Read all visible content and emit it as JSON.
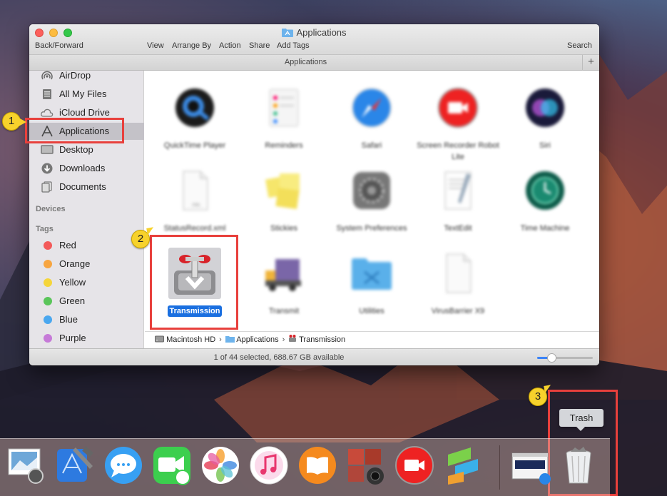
{
  "window": {
    "title": "Applications",
    "toolbar": {
      "back_forward": "Back/Forward",
      "view": "View",
      "arrange_by": "Arrange By",
      "action": "Action",
      "share": "Share",
      "add_tags": "Add Tags",
      "search": "Search"
    },
    "path_tab": "Applications",
    "plus": "+"
  },
  "sidebar": {
    "items": [
      {
        "label": "AirDrop",
        "icon": "airdrop-icon"
      },
      {
        "label": "All My Files",
        "icon": "all-files-icon"
      },
      {
        "label": "iCloud Drive",
        "icon": "cloud-icon"
      },
      {
        "label": "Applications",
        "icon": "applications-icon",
        "selected": true
      },
      {
        "label": "Desktop",
        "icon": "desktop-icon"
      },
      {
        "label": "Downloads",
        "icon": "downloads-icon"
      },
      {
        "label": "Documents",
        "icon": "documents-icon"
      }
    ],
    "devices_header": "Devices",
    "tags_header": "Tags",
    "tags": [
      {
        "label": "Red",
        "color": "#f35a5a"
      },
      {
        "label": "Orange",
        "color": "#f7a540"
      },
      {
        "label": "Yellow",
        "color": "#f5d53a"
      },
      {
        "label": "Green",
        "color": "#5ac55a"
      },
      {
        "label": "Blue",
        "color": "#4aa7ef"
      },
      {
        "label": "Purple",
        "color": "#c67ad8"
      }
    ]
  },
  "apps": [
    {
      "label": "QuickTime Player",
      "icon": "quicktime-icon"
    },
    {
      "label": "Reminders",
      "icon": "reminders-icon"
    },
    {
      "label": "Safari",
      "icon": "safari-icon"
    },
    {
      "label": "Screen Recorder Robot Lite",
      "icon": "screen-recorder-icon"
    },
    {
      "label": "Siri",
      "icon": "siri-icon"
    },
    {
      "label": "StatusRecord.xml",
      "icon": "xml-file-icon"
    },
    {
      "label": "Stickies",
      "icon": "stickies-icon"
    },
    {
      "label": "System Preferences",
      "icon": "system-preferences-icon"
    },
    {
      "label": "TextEdit",
      "icon": "textedit-icon"
    },
    {
      "label": "Time Machine",
      "icon": "time-machine-icon"
    },
    {
      "label": "Transmission",
      "icon": "transmission-icon",
      "selected": true
    },
    {
      "label": "Transmit",
      "icon": "transmit-icon"
    },
    {
      "label": "Utilities",
      "icon": "utilities-folder-icon"
    },
    {
      "label": "VirusBarrier X9",
      "icon": "virusbarrier-icon"
    }
  ],
  "pathbar": {
    "disk": "Macintosh HD",
    "folder": "Applications",
    "item": "Transmission"
  },
  "status": {
    "text": "1 of 44 selected, 688.67 GB available",
    "icon_size_fraction": 0.25
  },
  "annotations": {
    "callout_1": "1",
    "callout_2": "2",
    "callout_3": "3",
    "color": "#e8403c"
  },
  "tooltip": "Trash",
  "dock": {
    "icons": [
      "preview-icon",
      "xcode-icon",
      "messages-icon",
      "facetime-icon",
      "photos-icon",
      "itunes-icon",
      "ibooks-icon",
      "photo-booth-icon",
      "screen-recorder-icon",
      "sublime-text-icon",
      "finder-window-icon",
      "trash-icon"
    ]
  }
}
